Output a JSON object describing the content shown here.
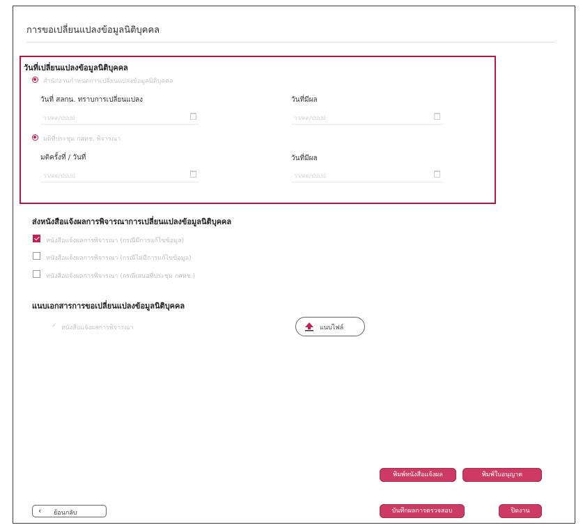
{
  "page": {
    "title": "การขอเปลี่ยนแปลงข้อมูลนิติบุคคล"
  },
  "change_date_section": {
    "title": "วันที่เปลี่ยนแปลงข้อมูลนิติบุคคล",
    "option1": {
      "label": "สำนักงานกำหนดการเปลี่ยนแปลงข้อมูลนิติบุคคล",
      "field_left_label": "วันที่ สลกน. ทราบการเปลี่ยนแปลง",
      "field_left_placeholder": "วว/ดด/ปปปป",
      "field_right_label": "วันที่มีผล",
      "field_right_placeholder": "วว/ดด/ปปปป"
    },
    "option2": {
      "label": "มติที่ประชุม กสทช. พิจารณา",
      "field_left_label": "มติครั้งที่ / วันที่",
      "field_left_placeholder": "วว/ดด/ปปปป",
      "field_right_label": "วันที่มีผล",
      "field_right_placeholder": "วว/ดด/ปปปป"
    }
  },
  "notify_section": {
    "title": "ส่งหนังสือแจ้งผลการพิจารณาการเปลี่ยนแปลงข้อมูลนิติบุคคล",
    "items": [
      {
        "label": "หนังสือแจ้งผลการพิจารณา (กรณีมีการแก้ไขข้อมูล)",
        "checked": true
      },
      {
        "label": "หนังสือแจ้งผลการพิจารณา (กรณีไม่มีการแก้ไขข้อมูล)",
        "checked": false
      },
      {
        "label": "หนังสือแจ้งผลการพิจารณา (กรณีเสนอที่ประชุม กสทช.)",
        "checked": false
      }
    ]
  },
  "attach_section": {
    "title": "แนบเอกสารการขอเปลี่ยนแปลงข้อมูลนิติบุคคล",
    "file_item": "หนังสือแจ้งผลการพิจารณา",
    "upload_label": "แนบไฟล์"
  },
  "actions": {
    "print_notice": "พิมพ์หนังสือแจ้งผล",
    "print_license": "พิมพ์ใบอนุญาต",
    "save_review": "บันทึกผลการตรวจสอบ",
    "close": "ปิดงาน",
    "back": "ย้อนกลับ"
  },
  "colors": {
    "accent": "#c22150",
    "section_border": "#b3163f",
    "button": "#cd3a62"
  }
}
